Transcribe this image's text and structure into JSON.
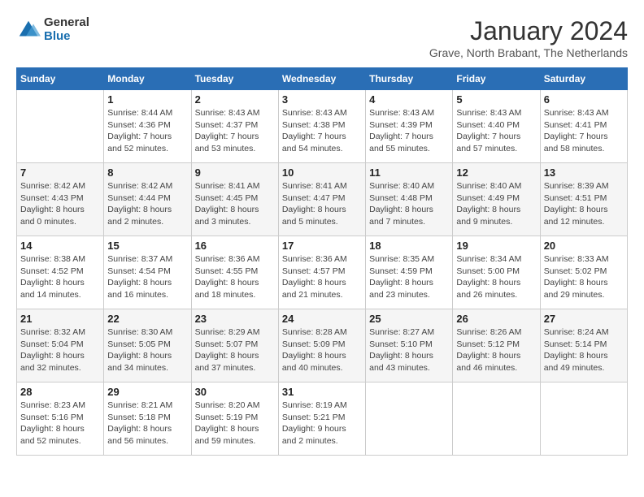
{
  "logo": {
    "general": "General",
    "blue": "Blue"
  },
  "title": {
    "month_year": "January 2024",
    "location": "Grave, North Brabant, The Netherlands"
  },
  "headers": [
    "Sunday",
    "Monday",
    "Tuesday",
    "Wednesday",
    "Thursday",
    "Friday",
    "Saturday"
  ],
  "weeks": [
    [
      {
        "day": "",
        "info": ""
      },
      {
        "day": "1",
        "info": "Sunrise: 8:44 AM\nSunset: 4:36 PM\nDaylight: 7 hours\nand 52 minutes."
      },
      {
        "day": "2",
        "info": "Sunrise: 8:43 AM\nSunset: 4:37 PM\nDaylight: 7 hours\nand 53 minutes."
      },
      {
        "day": "3",
        "info": "Sunrise: 8:43 AM\nSunset: 4:38 PM\nDaylight: 7 hours\nand 54 minutes."
      },
      {
        "day": "4",
        "info": "Sunrise: 8:43 AM\nSunset: 4:39 PM\nDaylight: 7 hours\nand 55 minutes."
      },
      {
        "day": "5",
        "info": "Sunrise: 8:43 AM\nSunset: 4:40 PM\nDaylight: 7 hours\nand 57 minutes."
      },
      {
        "day": "6",
        "info": "Sunrise: 8:43 AM\nSunset: 4:41 PM\nDaylight: 7 hours\nand 58 minutes."
      }
    ],
    [
      {
        "day": "7",
        "info": "Sunrise: 8:42 AM\nSunset: 4:43 PM\nDaylight: 8 hours\nand 0 minutes."
      },
      {
        "day": "8",
        "info": "Sunrise: 8:42 AM\nSunset: 4:44 PM\nDaylight: 8 hours\nand 2 minutes."
      },
      {
        "day": "9",
        "info": "Sunrise: 8:41 AM\nSunset: 4:45 PM\nDaylight: 8 hours\nand 3 minutes."
      },
      {
        "day": "10",
        "info": "Sunrise: 8:41 AM\nSunset: 4:47 PM\nDaylight: 8 hours\nand 5 minutes."
      },
      {
        "day": "11",
        "info": "Sunrise: 8:40 AM\nSunset: 4:48 PM\nDaylight: 8 hours\nand 7 minutes."
      },
      {
        "day": "12",
        "info": "Sunrise: 8:40 AM\nSunset: 4:49 PM\nDaylight: 8 hours\nand 9 minutes."
      },
      {
        "day": "13",
        "info": "Sunrise: 8:39 AM\nSunset: 4:51 PM\nDaylight: 8 hours\nand 12 minutes."
      }
    ],
    [
      {
        "day": "14",
        "info": "Sunrise: 8:38 AM\nSunset: 4:52 PM\nDaylight: 8 hours\nand 14 minutes."
      },
      {
        "day": "15",
        "info": "Sunrise: 8:37 AM\nSunset: 4:54 PM\nDaylight: 8 hours\nand 16 minutes."
      },
      {
        "day": "16",
        "info": "Sunrise: 8:36 AM\nSunset: 4:55 PM\nDaylight: 8 hours\nand 18 minutes."
      },
      {
        "day": "17",
        "info": "Sunrise: 8:36 AM\nSunset: 4:57 PM\nDaylight: 8 hours\nand 21 minutes."
      },
      {
        "day": "18",
        "info": "Sunrise: 8:35 AM\nSunset: 4:59 PM\nDaylight: 8 hours\nand 23 minutes."
      },
      {
        "day": "19",
        "info": "Sunrise: 8:34 AM\nSunset: 5:00 PM\nDaylight: 8 hours\nand 26 minutes."
      },
      {
        "day": "20",
        "info": "Sunrise: 8:33 AM\nSunset: 5:02 PM\nDaylight: 8 hours\nand 29 minutes."
      }
    ],
    [
      {
        "day": "21",
        "info": "Sunrise: 8:32 AM\nSunset: 5:04 PM\nDaylight: 8 hours\nand 32 minutes."
      },
      {
        "day": "22",
        "info": "Sunrise: 8:30 AM\nSunset: 5:05 PM\nDaylight: 8 hours\nand 34 minutes."
      },
      {
        "day": "23",
        "info": "Sunrise: 8:29 AM\nSunset: 5:07 PM\nDaylight: 8 hours\nand 37 minutes."
      },
      {
        "day": "24",
        "info": "Sunrise: 8:28 AM\nSunset: 5:09 PM\nDaylight: 8 hours\nand 40 minutes."
      },
      {
        "day": "25",
        "info": "Sunrise: 8:27 AM\nSunset: 5:10 PM\nDaylight: 8 hours\nand 43 minutes."
      },
      {
        "day": "26",
        "info": "Sunrise: 8:26 AM\nSunset: 5:12 PM\nDaylight: 8 hours\nand 46 minutes."
      },
      {
        "day": "27",
        "info": "Sunrise: 8:24 AM\nSunset: 5:14 PM\nDaylight: 8 hours\nand 49 minutes."
      }
    ],
    [
      {
        "day": "28",
        "info": "Sunrise: 8:23 AM\nSunset: 5:16 PM\nDaylight: 8 hours\nand 52 minutes."
      },
      {
        "day": "29",
        "info": "Sunrise: 8:21 AM\nSunset: 5:18 PM\nDaylight: 8 hours\nand 56 minutes."
      },
      {
        "day": "30",
        "info": "Sunrise: 8:20 AM\nSunset: 5:19 PM\nDaylight: 8 hours\nand 59 minutes."
      },
      {
        "day": "31",
        "info": "Sunrise: 8:19 AM\nSunset: 5:21 PM\nDaylight: 9 hours\nand 2 minutes."
      },
      {
        "day": "",
        "info": ""
      },
      {
        "day": "",
        "info": ""
      },
      {
        "day": "",
        "info": ""
      }
    ]
  ]
}
